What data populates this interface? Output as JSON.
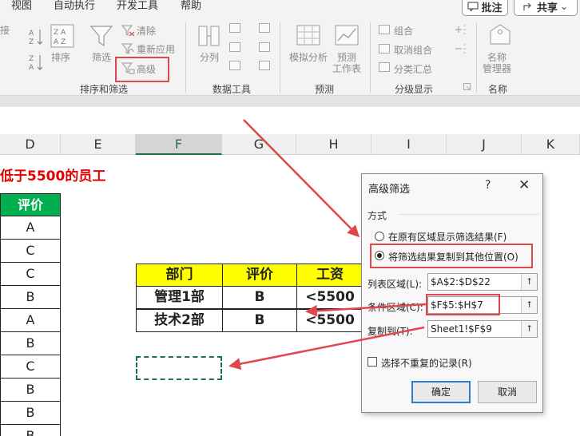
{
  "menubar": {
    "tabs": [
      "视图",
      "自动执行",
      "开发工具",
      "帮助"
    ],
    "comment_label": "批注",
    "share_label": "共享",
    "share_arrow": "⌄"
  },
  "ribbon": {
    "sort_filter": {
      "cut_left": "接",
      "sort_label": "排序",
      "filter_label": "筛选",
      "clear_label": "清除",
      "reapply_label": "重新应用",
      "advanced_label": "高级",
      "group_label": "排序和筛选"
    },
    "data_tools": {
      "split_label": "分列",
      "group_label": "数据工具"
    },
    "forecast": {
      "whatif_label": "模拟分析",
      "sheet_label": "预测",
      "sheet_label2": "工作表",
      "group_label": "预测"
    },
    "outline": {
      "group_btn": "组合",
      "ungroup_btn": "取消组合",
      "subtotal_btn": "分类汇总",
      "group_label": "分级显示"
    },
    "names": {
      "manager_label": "名称",
      "manager_label2": "管理器",
      "group_label": "名称"
    }
  },
  "grid": {
    "columns": [
      "D",
      "E",
      "F",
      "G",
      "H",
      "I",
      "J",
      "K"
    ],
    "selected_column": "F",
    "title_text": "低于5500的员工",
    "col_d_header": "评价",
    "col_d_values": [
      "A",
      "C",
      "C",
      "B",
      "A",
      "B",
      "C",
      "B",
      "B",
      "B"
    ],
    "criteria": {
      "headers": [
        "部门",
        "评价",
        "工资"
      ],
      "rows": [
        [
          "管理1部",
          "B",
          "<5500"
        ],
        [
          "技术2部",
          "B",
          "<5500"
        ]
      ]
    }
  },
  "dialog": {
    "title": "高级筛选",
    "help": "?",
    "close": "✕",
    "section_label": "方式",
    "option1": "在原有区域显示筛选结果(F)",
    "option2": "将筛选结果复制到其他位置(O)",
    "list_range_label": "列表区域(L):",
    "list_range_value": "$A$2:$D$22",
    "criteria_label": "条件区域(C):",
    "criteria_value": "$F$5:$H$7",
    "copy_to_label": "复制到(T):",
    "copy_to_value": "Sheet1!$F$9",
    "unique_label": "选择不重复的记录(R)",
    "ok_label": "确定",
    "cancel_label": "取消",
    "picker_glyph": "⭡"
  },
  "colors": {
    "excel_green": "#1e7145",
    "header_green": "#00b050",
    "criteria_yellow": "#ffff00",
    "annotation_red": "#e0474c",
    "title_red": "#e00000"
  }
}
